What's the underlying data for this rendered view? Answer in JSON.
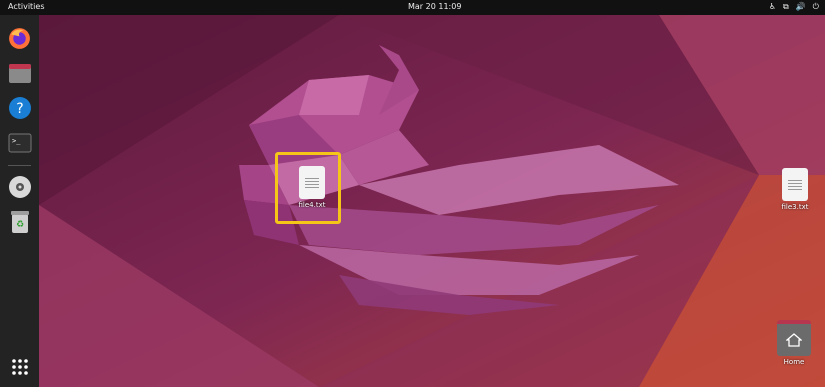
{
  "topbar": {
    "activities": "Activities",
    "clock": "Mar 20  11:09",
    "tray_icons": [
      "accessibility-icon",
      "network-icon",
      "volume-icon",
      "power-icon"
    ]
  },
  "dock": {
    "items": [
      {
        "name": "firefox",
        "icon": "firefox-icon"
      },
      {
        "name": "files",
        "icon": "files-icon"
      },
      {
        "name": "help",
        "icon": "help-icon"
      },
      {
        "name": "terminal",
        "icon": "terminal-icon"
      },
      {
        "name": "disc",
        "icon": "disc-icon"
      },
      {
        "name": "trash",
        "icon": "trash-icon"
      }
    ],
    "apps_grid": "show-applications-icon"
  },
  "desktop": {
    "file4": {
      "label": "file4.txt"
    },
    "file3": {
      "label": "file3.txt"
    },
    "home": {
      "label": "Home"
    }
  },
  "colors": {
    "highlight": "#f5c518",
    "topbar": "#111111",
    "dock": "#232323"
  }
}
